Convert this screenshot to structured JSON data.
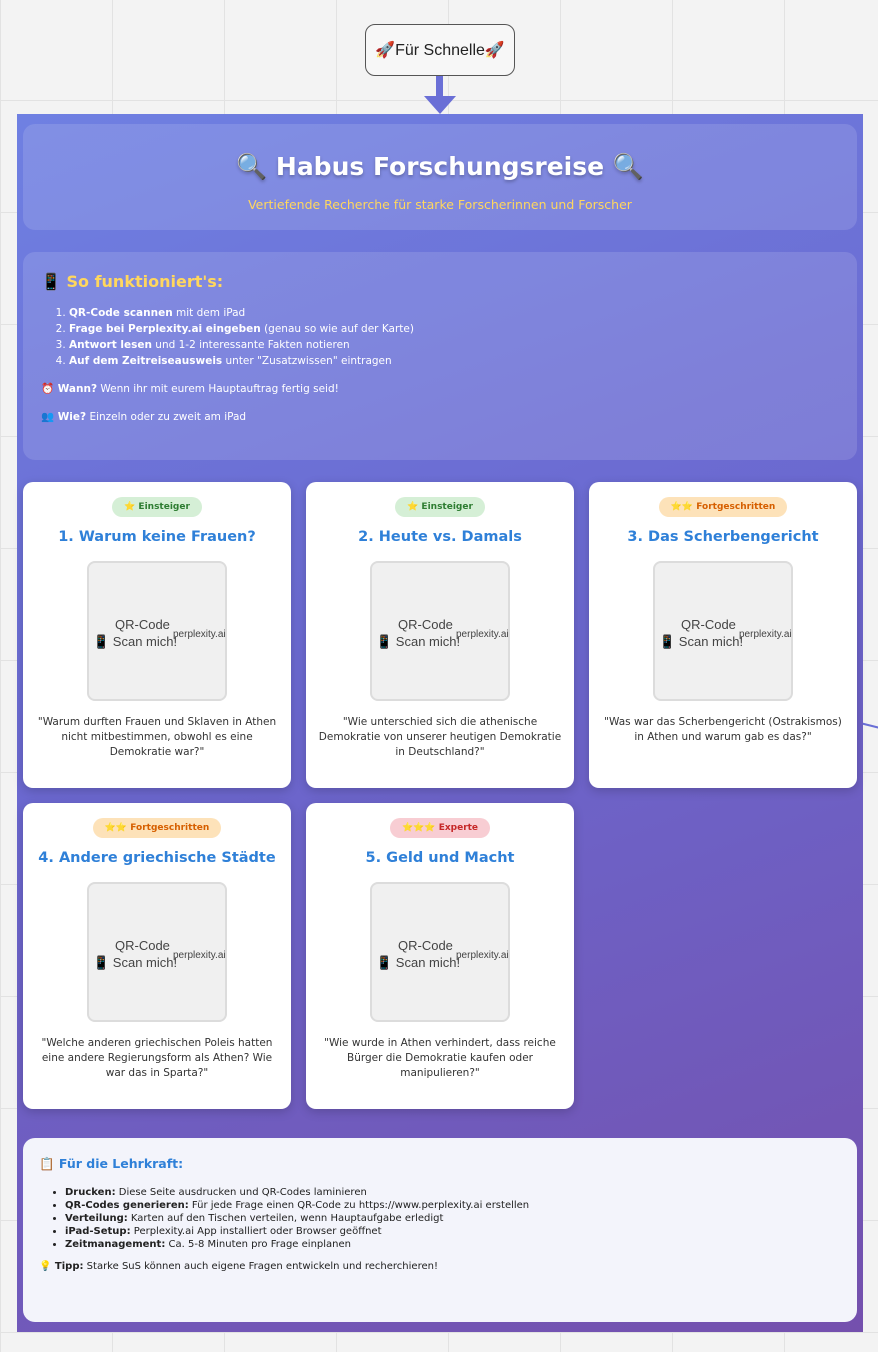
{
  "node": {
    "label": "🚀Für Schnelle🚀"
  },
  "header": {
    "title": "🔍 Habus Forschungsreise 🔍",
    "subtitle": "Vertiefende Recherche für starke Forscherinnen und Forscher"
  },
  "howto": {
    "title": "📱 So funktioniert's:",
    "steps": [
      {
        "bold": "QR-Code scannen",
        "rest": " mit dem iPad"
      },
      {
        "bold": "Frage bei Perplexity.ai eingeben",
        "rest": " (genau so wie auf der Karte)"
      },
      {
        "bold": "Antwort lesen",
        "rest": " und 1-2 interessante Fakten notieren"
      },
      {
        "bold": "Auf dem Zeitreiseausweis",
        "rest": " unter \"Zusatzwissen\" eintragen"
      }
    ],
    "when_label": "⏰ Wann?",
    "when_text": " Wenn ihr mit eurem Hauptauftrag fertig seid!",
    "how_label": "👥 Wie?",
    "how_text": " Einzeln oder zu zweit am iPad"
  },
  "qr": {
    "line1": "QR-Code",
    "line2": "📱 Scan mich!",
    "sup": "perplexity.ai"
  },
  "cards": [
    {
      "badge": "⭐ Einsteiger",
      "title": "1. Warum keine Frauen?",
      "question": "\"Warum durften Frauen und Sklaven in Athen nicht mitbestimmen, obwohl es eine Demokratie war?\""
    },
    {
      "badge": "⭐ Einsteiger",
      "title": "2. Heute vs. Damals",
      "question": "\"Wie unterschied sich die athenische Demokratie von unserer heutigen Demokratie in Deutschland?\""
    },
    {
      "badge": "⭐⭐ Fortgeschritten",
      "title": "3. Das Scherbengericht",
      "question": "\"Was war das Scherbengericht (Ostrakismos) in Athen und warum gab es das?\""
    },
    {
      "badge": "⭐⭐ Fortgeschritten",
      "title": "4. Andere griechische Städte",
      "question": "\"Welche anderen griechischen Poleis hatten eine andere Regierungsform als Athen? Wie war das in Sparta?\""
    },
    {
      "badge": "⭐⭐⭐ Experte",
      "title": "5. Geld und Macht",
      "question": "\"Wie wurde in Athen verhindert, dass reiche Bürger die Demokratie kaufen oder manipulieren?\""
    }
  ],
  "teacher": {
    "title": "📋 Für die Lehrkraft:",
    "items": [
      {
        "bold": "Drucken:",
        "rest": " Diese Seite ausdrucken und QR-Codes laminieren"
      },
      {
        "bold": "QR-Codes generieren:",
        "rest": " Für jede Frage einen QR-Code zu https://www.perplexity.ai erstellen"
      },
      {
        "bold": "Verteilung:",
        "rest": " Karten auf den Tischen verteilen, wenn Hauptaufgabe erledigt"
      },
      {
        "bold": "iPad-Setup:",
        "rest": " Perplexity.ai App installiert oder Browser geöffnet"
      },
      {
        "bold": "Zeitmanagement:",
        "rest": " Ca. 5-8 Minuten pro Frage einplanen"
      }
    ],
    "tip_label": "💡 Tipp:",
    "tip_text": " Starke SuS können auch eigene Fragen entwickeln und recherchieren!"
  },
  "colors": {
    "accent": "#2f80d8",
    "yellow": "#ffd75e",
    "connector": "#6a6fd6"
  }
}
